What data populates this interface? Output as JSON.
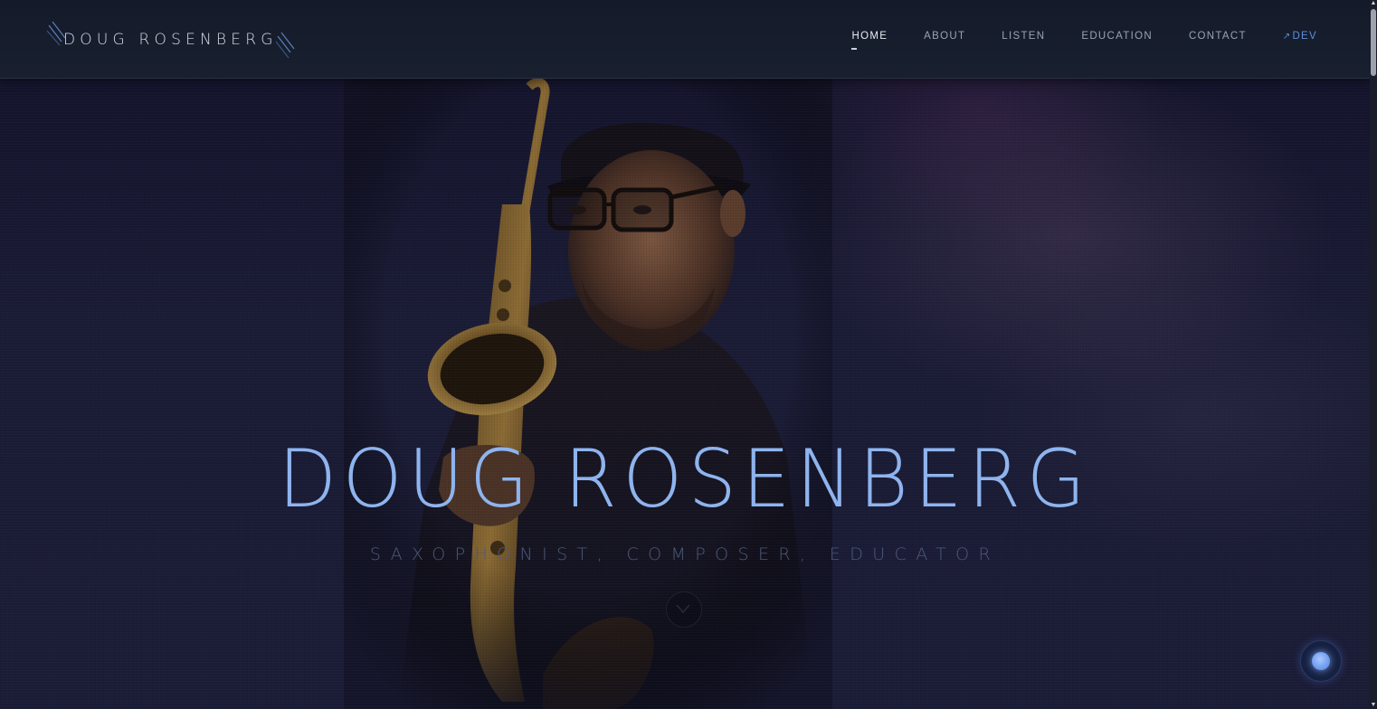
{
  "header": {
    "logo_text": "DOUG ROSENBERG",
    "nav": [
      {
        "label": "HOME",
        "active": true
      },
      {
        "label": "ABOUT"
      },
      {
        "label": "LISTEN"
      },
      {
        "label": "EDUCATION"
      },
      {
        "label": "CONTACT"
      },
      {
        "label": "DEV",
        "icon": "external-arrow-icon"
      }
    ]
  },
  "hero": {
    "title": "DOUG ROSENBERG",
    "subtitle": "SAXOPHONIST, COMPOSER, EDUCATOR",
    "scroll_icon": "chevron-down-icon",
    "fab_icon": "chat-bubble-icon"
  },
  "colors": {
    "accent": "#8eb4ee",
    "link_dev": "#5e8fd6",
    "background": "#14152a",
    "header": "#161d2c"
  }
}
